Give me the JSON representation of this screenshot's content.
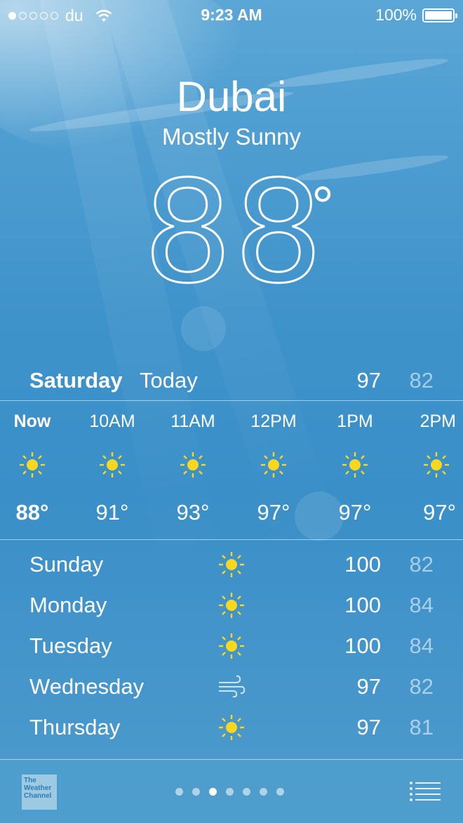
{
  "status_bar": {
    "carrier": "du",
    "time": "9:23 AM",
    "battery": "100%",
    "signal_bars_filled": 1,
    "signal_bars_total": 5
  },
  "header": {
    "city": "Dubai",
    "condition": "Mostly Sunny",
    "temperature": "88",
    "degree": "°"
  },
  "today": {
    "day": "Saturday",
    "label": "Today",
    "high": "97",
    "low": "82"
  },
  "hourly": [
    {
      "time": "Now",
      "icon": "sun-icon",
      "temp": "88°"
    },
    {
      "time": "10AM",
      "icon": "sun-icon",
      "temp": "91°"
    },
    {
      "time": "11AM",
      "icon": "sun-icon",
      "temp": "93°"
    },
    {
      "time": "12PM",
      "icon": "sun-icon",
      "temp": "97°"
    },
    {
      "time": "1PM",
      "icon": "sun-icon",
      "temp": "97°"
    },
    {
      "time": "2PM",
      "icon": "sun-icon",
      "temp": "97°"
    }
  ],
  "daily": [
    {
      "day": "Sunday",
      "icon": "sun-icon",
      "high": "100",
      "low": "82"
    },
    {
      "day": "Monday",
      "icon": "sun-icon",
      "high": "100",
      "low": "84"
    },
    {
      "day": "Tuesday",
      "icon": "sun-icon",
      "high": "100",
      "low": "84"
    },
    {
      "day": "Wednesday",
      "icon": "wind-icon",
      "high": "97",
      "low": "82"
    },
    {
      "day": "Thursday",
      "icon": "sun-icon",
      "high": "97",
      "low": "81"
    }
  ],
  "toolbar": {
    "logo_text": "The Weather Channel",
    "page_count": 7,
    "active_page": 3
  },
  "colors": {
    "sun": "#f9d71c",
    "sky": "#3f93cb"
  }
}
